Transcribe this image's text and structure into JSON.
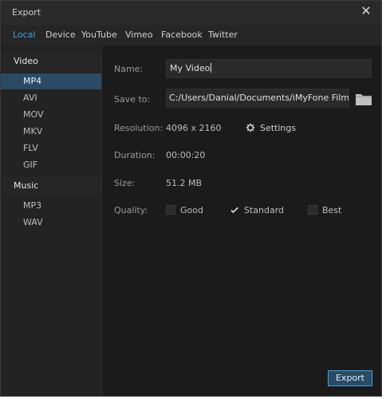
{
  "window": {
    "title": "Export"
  },
  "tabs": [
    {
      "label": "Local"
    },
    {
      "label": "Device"
    },
    {
      "label": "YouTube"
    },
    {
      "label": "Vimeo"
    },
    {
      "label": "Facebook"
    },
    {
      "label": "Twitter"
    }
  ],
  "sidebar": {
    "video_title": "Video",
    "video_formats": [
      "MP4",
      "AVI",
      "MOV",
      "MKV",
      "FLV",
      "GIF"
    ],
    "selected_video_format": "MP4",
    "music_title": "Music",
    "music_formats": [
      "MP3",
      "WAV"
    ]
  },
  "form": {
    "name_label": "Name:",
    "name_value": "My Video",
    "save_label": "Save to:",
    "save_path": "C:/Users/Danial/Documents/iMyFone Filme...",
    "resolution_label": "Resolution:",
    "resolution_value": "4096 x 2160",
    "settings_label": "Settings",
    "duration_label": "Duration:",
    "duration_value": "00:00:20",
    "size_label": "Size:",
    "size_value": "51.2 MB",
    "quality_label": "Quality:",
    "quality_options": [
      "Good",
      "Standard",
      "Best"
    ],
    "quality_selected": "Standard"
  },
  "actions": {
    "export_label": "Export"
  },
  "colors": {
    "accent": "#3aa5e6",
    "selection": "#2b4a63"
  }
}
